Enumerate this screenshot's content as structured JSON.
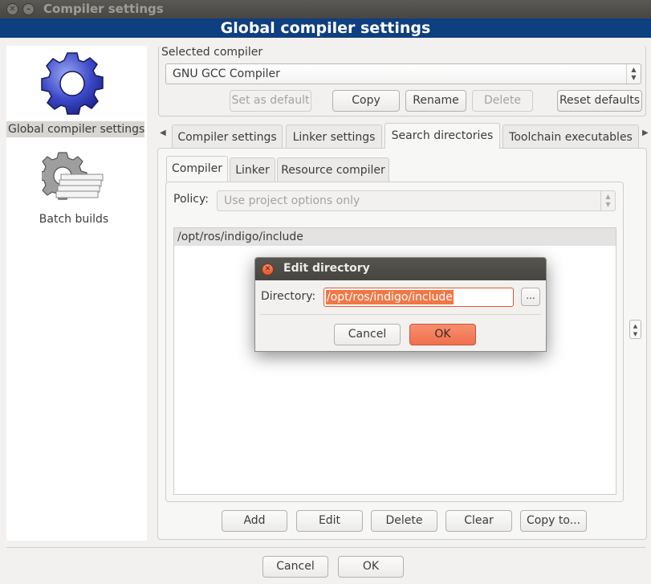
{
  "window": {
    "title": "Compiler settings"
  },
  "banner": {
    "title": "Global compiler settings"
  },
  "sidebar": {
    "items": [
      {
        "label": "Global compiler settings",
        "icon": "gear-icon",
        "selected": true
      },
      {
        "label": "Batch builds",
        "icon": "batch-builds-icon",
        "selected": false
      }
    ]
  },
  "compiler": {
    "group_label": "Selected compiler",
    "selected": "GNU GCC Compiler",
    "buttons": {
      "set_default": "Set as default",
      "copy": "Copy",
      "rename": "Rename",
      "delete": "Delete",
      "reset_defaults": "Reset defaults"
    }
  },
  "tabs": [
    "Compiler settings",
    "Linker settings",
    "Search directories",
    "Toolchain executables"
  ],
  "active_tab": "Search directories",
  "subtabs": [
    "Compiler",
    "Linker",
    "Resource compiler"
  ],
  "active_subtab": "Compiler",
  "policy": {
    "label": "Policy:",
    "value": "Use project options only"
  },
  "directories": [
    "/opt/ros/indigo/include"
  ],
  "dir_buttons": {
    "add": "Add",
    "edit": "Edit",
    "delete": "Delete",
    "clear": "Clear",
    "copy_to": "Copy to..."
  },
  "footer": {
    "cancel": "Cancel",
    "ok": "OK"
  },
  "dialog": {
    "title": "Edit directory",
    "label": "Directory:",
    "value": "/opt/ros/indigo/include",
    "browse": "...",
    "cancel": "Cancel",
    "ok": "OK"
  },
  "colors": {
    "banner": "#0e3f80",
    "selection": "#f07746",
    "primary_button": "#f07a58"
  }
}
